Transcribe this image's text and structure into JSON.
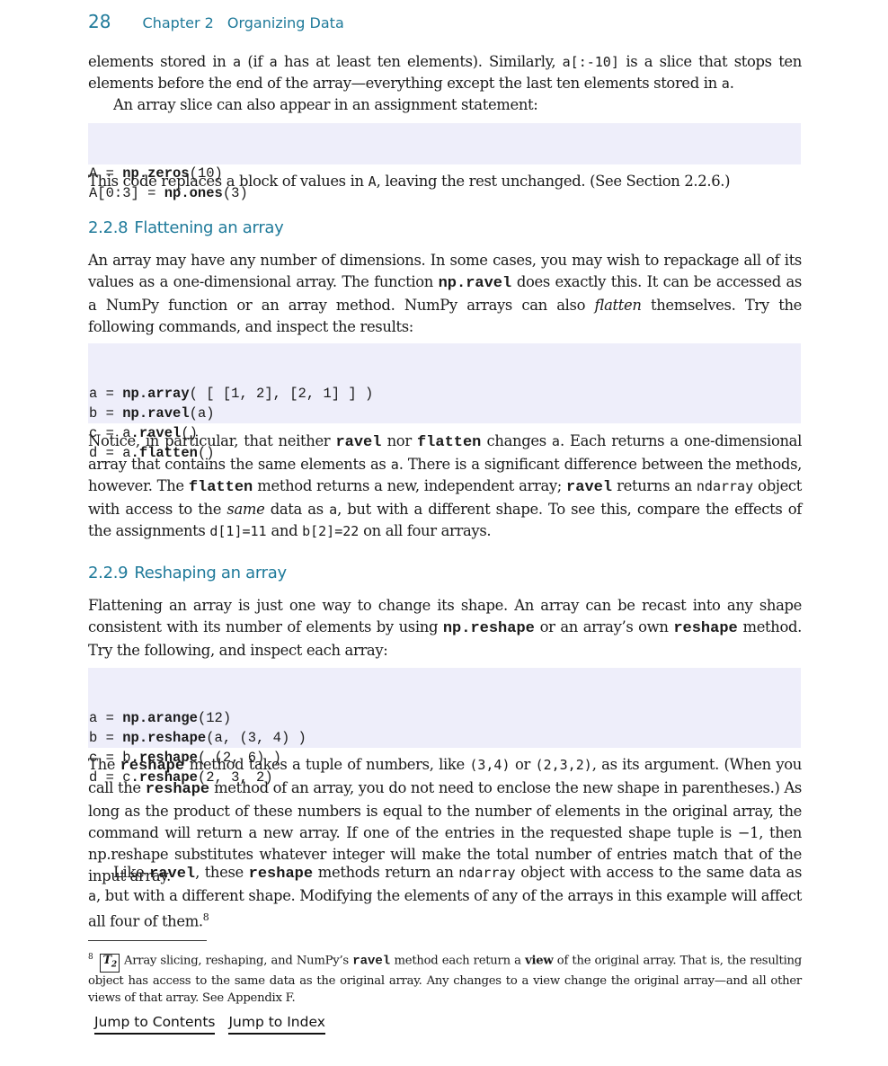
{
  "header": {
    "page_number": "28",
    "chapter_label": "Chapter 2",
    "chapter_title": "Organizing Data"
  },
  "intro": {
    "p1": {
      "t1": "elements stored in ",
      "c1": "a",
      "t2": " (if ",
      "c2": "a",
      "t3": " has at least ten elements). Similarly, ",
      "c3": "a[:-10]",
      "t4": " is a slice that stops ten elements before the end of the array—everything except the last ten elements stored in ",
      "c4": "a",
      "t5": "."
    },
    "p2": "An array slice can also appear in an assignment statement:",
    "code": [
      {
        "pre": "A = ",
        "bold": "np.zeros",
        "post": "(10)"
      },
      {
        "pre": "A[0:3] = ",
        "bold": "np.ones",
        "post": "(3)"
      }
    ],
    "p3": {
      "t1": "This code replaces a block of values in ",
      "c1": "A",
      "t2": ", leaving the rest unchanged. (See Section 2.2.6.)"
    }
  },
  "section_228": {
    "number": "2.2.8",
    "title": "Flattening an array",
    "p1": {
      "t1": "An array may have any number of dimensions. In some cases, you may wish to repackage all of its values as a one-dimensional array. The function ",
      "b1": "np.ravel",
      "t2": " does exactly this. It can be accessed as a NumPy function or an array method. NumPy arrays can also ",
      "i1": "flatten",
      "t3": " themselves. Try the following commands, and inspect the results:"
    },
    "code": [
      {
        "pre": "a = ",
        "bold": "np.array",
        "post": "( [ [1, 2], [2, 1] ] )"
      },
      {
        "pre": "b = ",
        "bold": "np.ravel",
        "post": "(a)"
      },
      {
        "pre": "c = a",
        "bold": ".ravel",
        "post": "()"
      },
      {
        "pre": "d = a",
        "bold": ".flatten",
        "post": "()"
      }
    ],
    "p2": {
      "t1": "Notice, in particular, that neither ",
      "b1": "ravel",
      "t2": " nor ",
      "b2": "flatten",
      "t3": " changes ",
      "c1": "a",
      "t4": ". Each returns a one-dimensional array that contains the same elements as ",
      "c2": "a",
      "t5": ". There is a significant difference between the methods, however. The ",
      "b3": "flatten",
      "t6": " method returns a new, independent array; ",
      "b4": "ravel",
      "t7": " returns an ",
      "c3": "ndarray",
      "t8": " object with access to the ",
      "i1": "same",
      "t9": " data as ",
      "c4": "a",
      "t10": ", but with a different shape. To see this, compare the effects of the assignments ",
      "c5": "d[1]=11",
      "t11": " and ",
      "c6": "b[2]=22",
      "t12": " on all four arrays."
    }
  },
  "section_229": {
    "number": "2.2.9",
    "title": "Reshaping an array",
    "p1": {
      "t1": "Flattening an array is just one way to change its shape. An array can be recast into any shape consistent with its number of elements by using ",
      "b1": "np.reshape",
      "t2": " or an array’s own ",
      "b2": "reshape",
      "t3": " method. Try the following, and inspect each array:"
    },
    "code": [
      {
        "pre": "a = ",
        "bold": "np.arange",
        "post": "(12)"
      },
      {
        "pre": "b = ",
        "bold": "np.reshape",
        "post": "(a, (3, 4) )"
      },
      {
        "pre": "c = b",
        "bold": ".reshape",
        "post": "( (2, 6) )"
      },
      {
        "pre": "d = c",
        "bold": ".reshape",
        "post": "(2, 3, 2)"
      }
    ],
    "p2": {
      "t1": "The ",
      "b1": "reshape",
      "t2": " method takes a tuple of numbers, like ",
      "c1": "(3,4)",
      "t3": " or ",
      "c2": "(2,3,2)",
      "t4": ", as its argument. (When you call the ",
      "b2": "reshape",
      "t5": " method of an array, you do not need to enclose the new shape in parentheses.) As long as the product of these numbers is equal to the number of elements in the original array, the command will return a new array. If one of the entries in the requested shape tuple is −1, then np.reshape substitutes whatever integer will make the total number of entries match that of the input array."
    },
    "p3": {
      "t1": "Like ",
      "b1": "ravel",
      "t2": ", these ",
      "b2": "reshape",
      "t3": " methods return an ",
      "c1": "ndarray",
      "t4": " object with access to the same data as ",
      "c2": "a",
      "t5": ", but with a different shape. Modifying the elements of any of the arrays in this example will affect all four of them.",
      "fnref": "8"
    }
  },
  "footnote": {
    "marker": "8",
    "badge_main": "T",
    "badge_sub": "2",
    "t1": "Array slicing, reshaping, and NumPy’s ",
    "b1": "ravel",
    "t2": " method each return a ",
    "strong1": "view",
    "t3": " of the original array. That is, the resulting object has access to the same data as the original array. Any changes to a view change the original array—and all other views of that array. See Appendix F."
  },
  "nav": {
    "contents_label": "Jump to Contents",
    "index_label": "Jump to Index"
  },
  "colors": {
    "heading_accent": "#1f7a9a",
    "code_background": "#eeeefa"
  }
}
